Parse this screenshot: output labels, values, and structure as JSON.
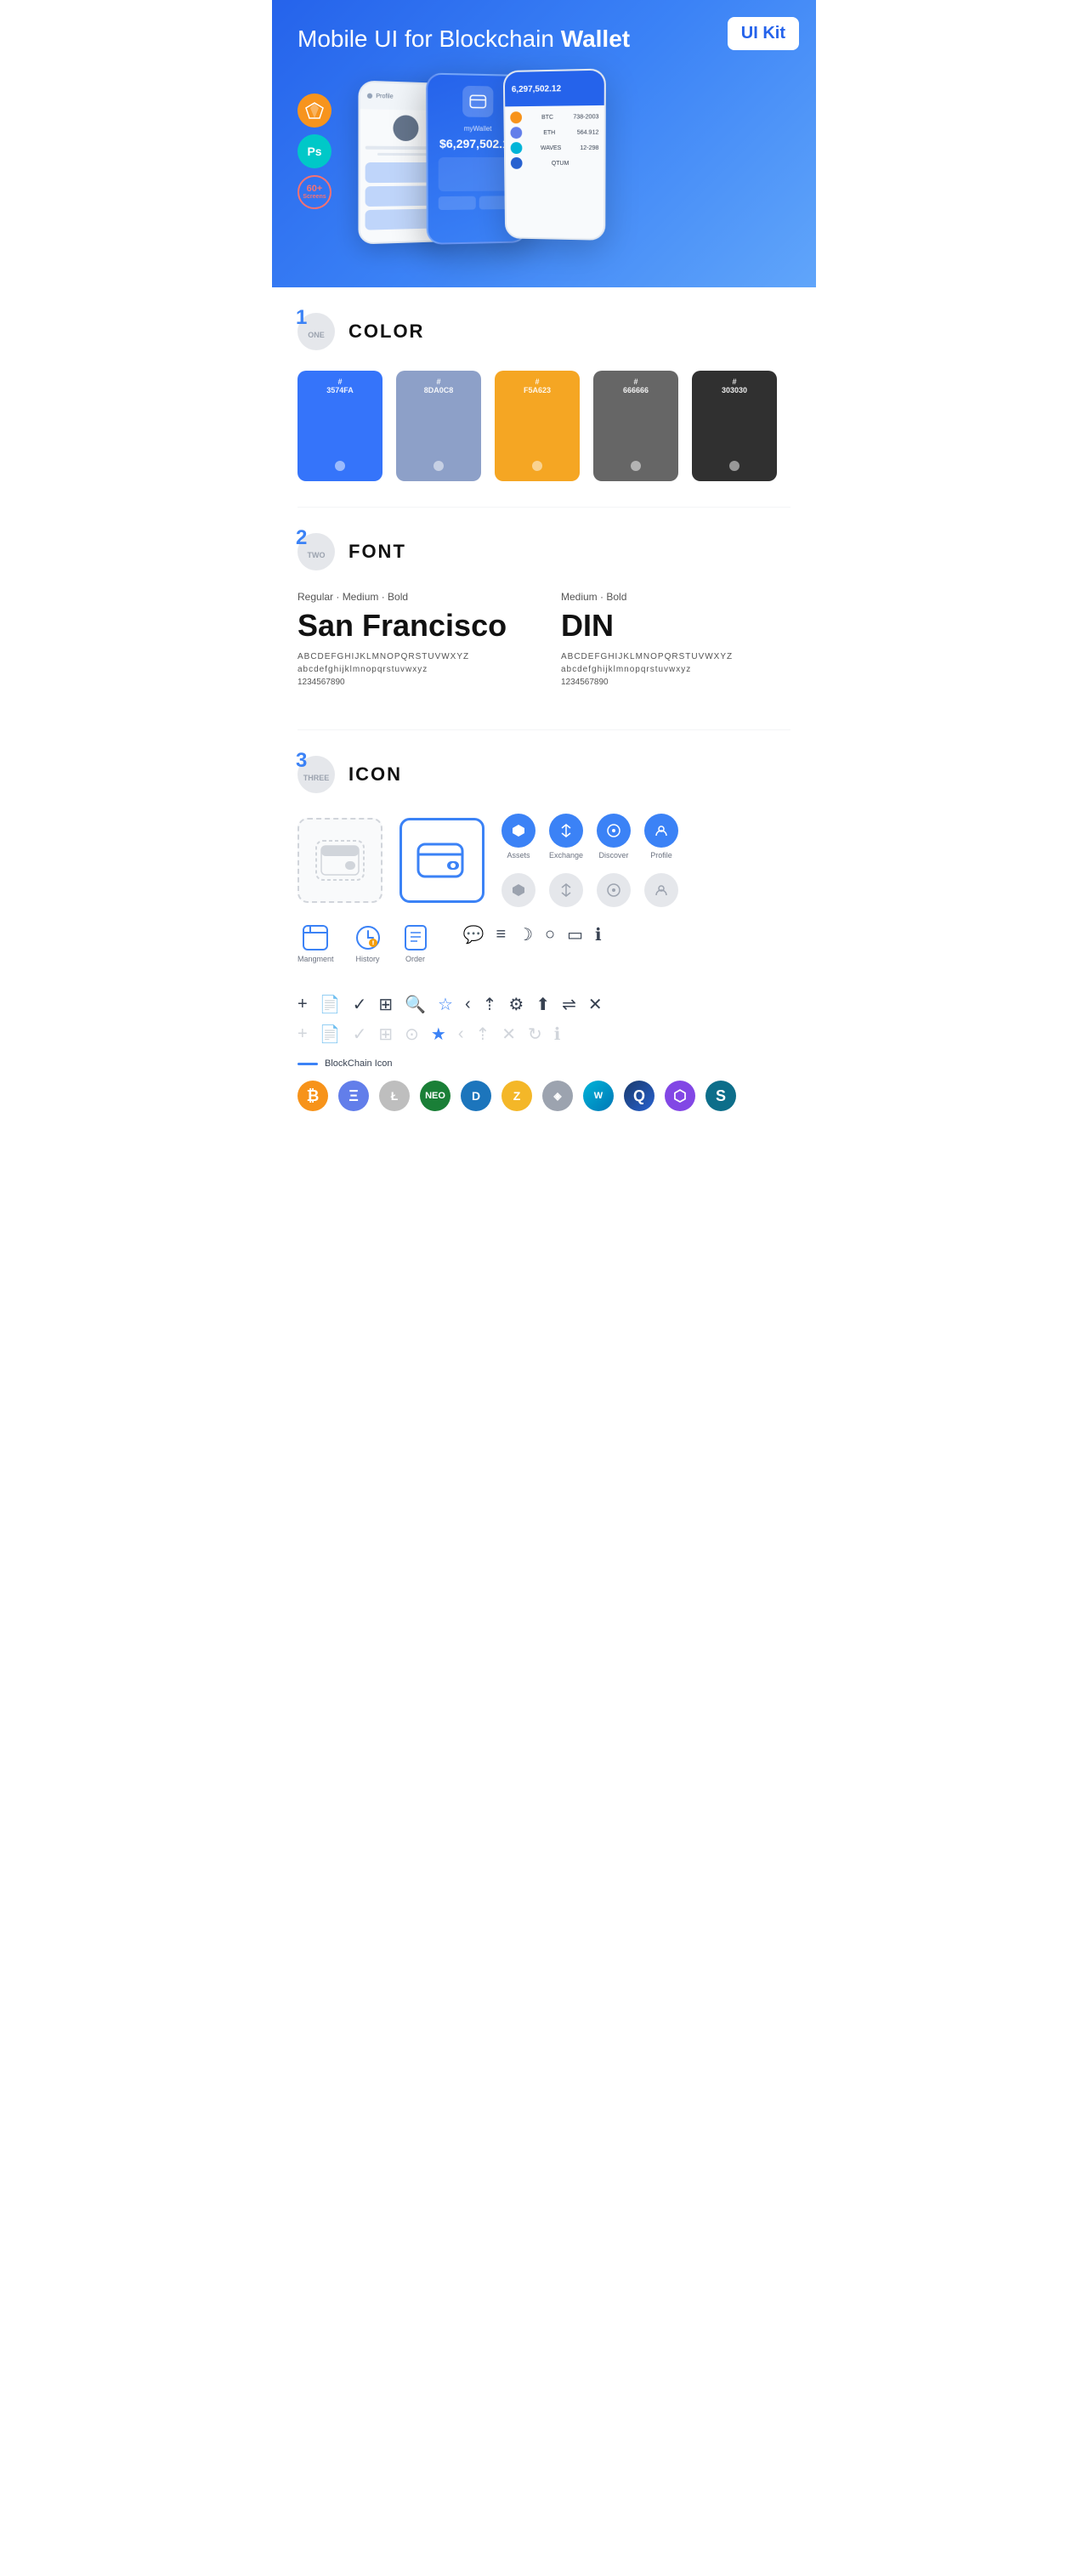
{
  "hero": {
    "title": "Mobile UI for Blockchain ",
    "title_bold": "Wallet",
    "badge": "UI Kit",
    "badges": [
      {
        "id": "sketch",
        "label": "Sk"
      },
      {
        "id": "ps",
        "label": "Ps"
      },
      {
        "id": "screens",
        "line1": "60+",
        "line2": "Screens"
      }
    ]
  },
  "sections": {
    "color": {
      "number": "1",
      "number_text": "ONE",
      "title": "COLOR",
      "swatches": [
        {
          "hex": "#3574FA",
          "label": "#\n3574FA"
        },
        {
          "hex": "#8DA0C8",
          "label": "#\n8DA0C8"
        },
        {
          "hex": "#F5A623",
          "label": "#\nF5A623"
        },
        {
          "hex": "#666666",
          "label": "#\n666666"
        },
        {
          "hex": "#303030",
          "label": "#\n303030"
        }
      ]
    },
    "font": {
      "number": "2",
      "number_text": "TWO",
      "title": "FONT",
      "fonts": [
        {
          "weights": "Regular · Medium · Bold",
          "name": "San Francisco",
          "uppercase": "ABCDEFGHIJKLMNOPQRSTUVWXYZ",
          "lowercase": "abcdefghijklmnopqrstuvwxyz",
          "nums": "1234567890"
        },
        {
          "weights": "Medium · Bold",
          "name": "DIN",
          "uppercase": "ABCDEFGHIJKLMNOPQRSTUVWXYZ",
          "lowercase": "abcdefghijklmnopqrstuvwxyz",
          "nums": "1234567890"
        }
      ]
    },
    "icon": {
      "number": "3",
      "number_text": "THREE",
      "title": "ICON",
      "named_icons": [
        {
          "label": "Assets"
        },
        {
          "label": "Exchange"
        },
        {
          "label": "Discover"
        },
        {
          "label": "Profile"
        }
      ],
      "bottom_icons": [
        {
          "label": "Mangment"
        },
        {
          "label": "History"
        },
        {
          "label": "Order"
        }
      ],
      "bc_label": "BlockChain Icon",
      "crypto_coins": [
        {
          "id": "btc",
          "symbol": "₿",
          "css": "crypto-btc"
        },
        {
          "id": "eth",
          "symbol": "Ξ",
          "css": "crypto-eth"
        },
        {
          "id": "ltc",
          "symbol": "Ł",
          "css": "crypto-ltc"
        },
        {
          "id": "neo",
          "symbol": "N",
          "css": "crypto-neo"
        },
        {
          "id": "dash",
          "symbol": "D",
          "css": "crypto-dash"
        },
        {
          "id": "zcash",
          "symbol": "Z",
          "css": "crypto-zcash"
        },
        {
          "id": "grid",
          "symbol": "◈",
          "css": "crypto-grid"
        },
        {
          "id": "waves",
          "symbol": "W",
          "css": "crypto-waves"
        },
        {
          "id": "qtum",
          "symbol": "Q",
          "css": "crypto-qtum"
        },
        {
          "id": "polygon",
          "symbol": "⬡",
          "css": "crypto-polygon"
        },
        {
          "id": "sky",
          "symbol": "S",
          "css": "crypto-sky"
        }
      ]
    }
  }
}
